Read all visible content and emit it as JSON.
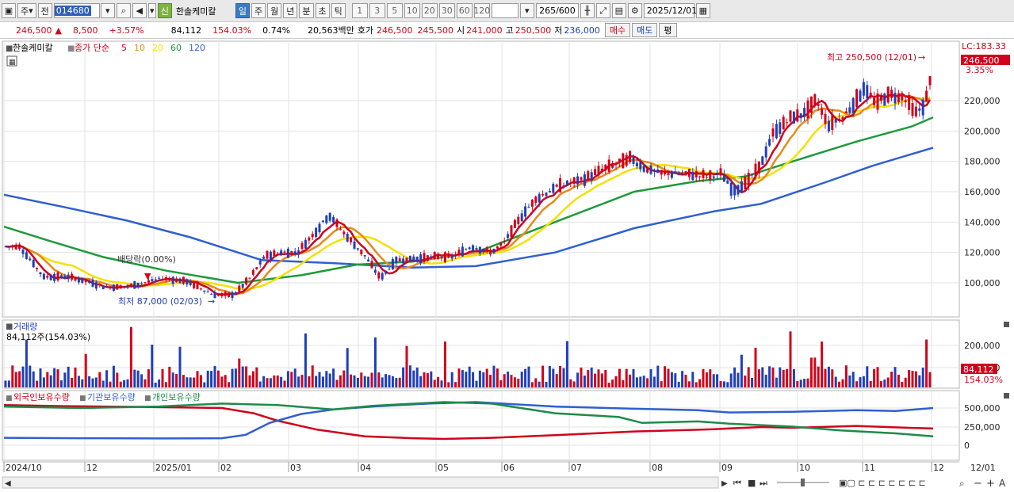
{
  "toolbar": {
    "market": "주",
    "prev_label": "전",
    "code": "014680",
    "stock_name": "한솔케미칼",
    "new_label": "신",
    "periods": [
      "일",
      "주",
      "월",
      "년",
      "분",
      "초",
      "틱"
    ],
    "active_period": "일",
    "intervals": [
      "1",
      "3",
      "5",
      "10",
      "20",
      "30",
      "60",
      "120"
    ],
    "count": "265",
    "count_total": "/600",
    "date": "2025/12/01"
  },
  "quote": {
    "price": "246,500",
    "arrow": "▲",
    "change": "8,500",
    "change_pct": "+3.57%",
    "volume": "84,112",
    "volume_ratio": "154.03%",
    "turnover": "0.74%",
    "amount": "20,563백만",
    "hoga_label": "호가",
    "ask": "246,500",
    "bid": "245,500",
    "open_label": "시",
    "open": "241,000",
    "high_label": "고",
    "high": "250,500",
    "low_label": "저",
    "low": "236,000",
    "buy": "매수",
    "sell": "매도",
    "avg": "평"
  },
  "price_panel": {
    "name": "한솔케미칼",
    "legend_prefix": "종가 단순",
    "ma": [
      {
        "period": "5",
        "color": "#d0021b"
      },
      {
        "period": "10",
        "color": "#e8891a"
      },
      {
        "period": "20",
        "color": "#f2e100"
      },
      {
        "period": "60",
        "color": "#1e9a3a"
      },
      {
        "period": "120",
        "color": "#2f5fd0"
      }
    ],
    "lc_label": "LC:183.33",
    "last_price_tag": "246,500",
    "last_pct_tag": "3.35%",
    "high_note": "최고 250,500 (12/01)",
    "low_note": "최저 87,000 (02/03)",
    "dividend_note": "배당락(0.00%)",
    "y_ticks": [
      "220,000",
      "200,000",
      "180,000",
      "160,000",
      "140,000",
      "120,000",
      "100,000"
    ],
    "y_values": [
      220000,
      200000,
      180000,
      160000,
      140000,
      120000,
      100000
    ]
  },
  "volume_panel": {
    "title": "거래량",
    "value": "84,112주(154.03%)",
    "y_ticks": [
      "200,000",
      "100,000"
    ],
    "last_tag": "84,112",
    "last_pct": "154.03%"
  },
  "holdings_panel": {
    "legend": [
      {
        "name": "외국인보유수량",
        "color": "#d0021b"
      },
      {
        "name": "기관보유수량",
        "color": "#2f5fd0"
      },
      {
        "name": "개인보유수량",
        "color": "#1e8a4a"
      }
    ],
    "y_ticks": [
      "500,000",
      "250,000",
      "0"
    ]
  },
  "x_axis": {
    "labels": [
      "2024/10",
      "12",
      "2025/01",
      "02",
      "03",
      "04",
      "05",
      "06",
      "07",
      "08",
      "09",
      "10",
      "11",
      "12",
      "12/01"
    ]
  },
  "colors": {
    "up": "#d0021b",
    "down": "#1f3fb8",
    "grid": "#e3e3e3"
  }
}
